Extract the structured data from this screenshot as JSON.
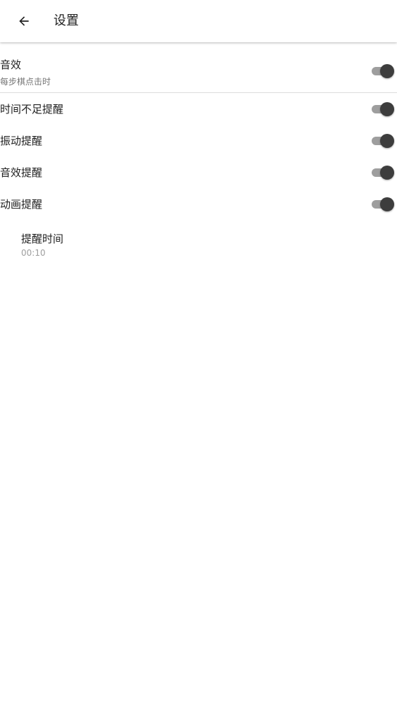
{
  "app_bar": {
    "back_icon": "arrow-left-icon",
    "title": "设置"
  },
  "settings": {
    "sound_effects": {
      "title": "音效",
      "summary": "每步棋点击时",
      "enabled": true
    },
    "low_time_alert": {
      "title": "时间不足提醒",
      "enabled": true
    },
    "vibration_alert": {
      "title": "振动提醒",
      "enabled": true
    },
    "sound_alert": {
      "title": "音效提醒",
      "enabled": true
    },
    "animation_alert": {
      "title": "动画提醒",
      "enabled": true
    },
    "alert_time": {
      "title": "提醒时间",
      "value": "00:10"
    }
  },
  "colors": {
    "switch_thumb": "#3d3d3d",
    "switch_track": "#9e9e9e",
    "primary_text": "#212121",
    "secondary_text": "#757575"
  }
}
